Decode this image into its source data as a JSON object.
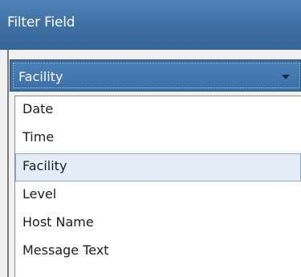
{
  "header": {
    "title": "Filter Field"
  },
  "select": {
    "value": "Facility"
  },
  "dropdown": {
    "options": [
      {
        "label": "Date"
      },
      {
        "label": "Time"
      },
      {
        "label": "Facility"
      },
      {
        "label": "Level"
      },
      {
        "label": "Host Name"
      },
      {
        "label": "Message Text"
      }
    ],
    "selected_label": "Facility"
  },
  "colors": {
    "header": "#3e6fa3",
    "selection": "#e4eef8"
  }
}
